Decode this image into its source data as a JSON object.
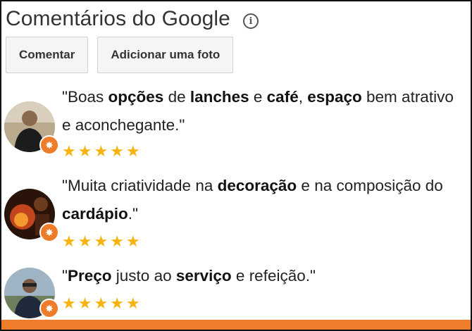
{
  "header": {
    "title": "Comentários do Google",
    "info_icon": "info-icon"
  },
  "buttons": {
    "comment_label": "Comentar",
    "add_photo_label": "Adicionar uma foto"
  },
  "reviews": [
    {
      "segments": [
        {
          "t": "\"Boas ",
          "b": false
        },
        {
          "t": "opções",
          "b": true
        },
        {
          "t": " de ",
          "b": false
        },
        {
          "t": "lanches",
          "b": true
        },
        {
          "t": " e ",
          "b": false
        },
        {
          "t": "café",
          "b": true
        },
        {
          "t": ", ",
          "b": false
        },
        {
          "t": "espaço",
          "b": true
        },
        {
          "t": " bem atrativo e aconchegante.\"",
          "b": false
        }
      ],
      "rating": 5
    },
    {
      "segments": [
        {
          "t": "\"Muita criatividade na ",
          "b": false
        },
        {
          "t": "decoração",
          "b": true
        },
        {
          "t": " e na composição do ",
          "b": false
        },
        {
          "t": "cardápio",
          "b": true
        },
        {
          "t": ".\"",
          "b": false
        }
      ],
      "rating": 5
    },
    {
      "segments": [
        {
          "t": "\"",
          "b": false
        },
        {
          "t": "Preço",
          "b": true
        },
        {
          "t": " justo ao ",
          "b": false
        },
        {
          "t": "serviço",
          "b": true
        },
        {
          "t": " e refeição.\"",
          "b": false
        }
      ],
      "rating": 5
    }
  ],
  "colors": {
    "star": "#f7b30f",
    "accent": "#ee7d2b"
  }
}
